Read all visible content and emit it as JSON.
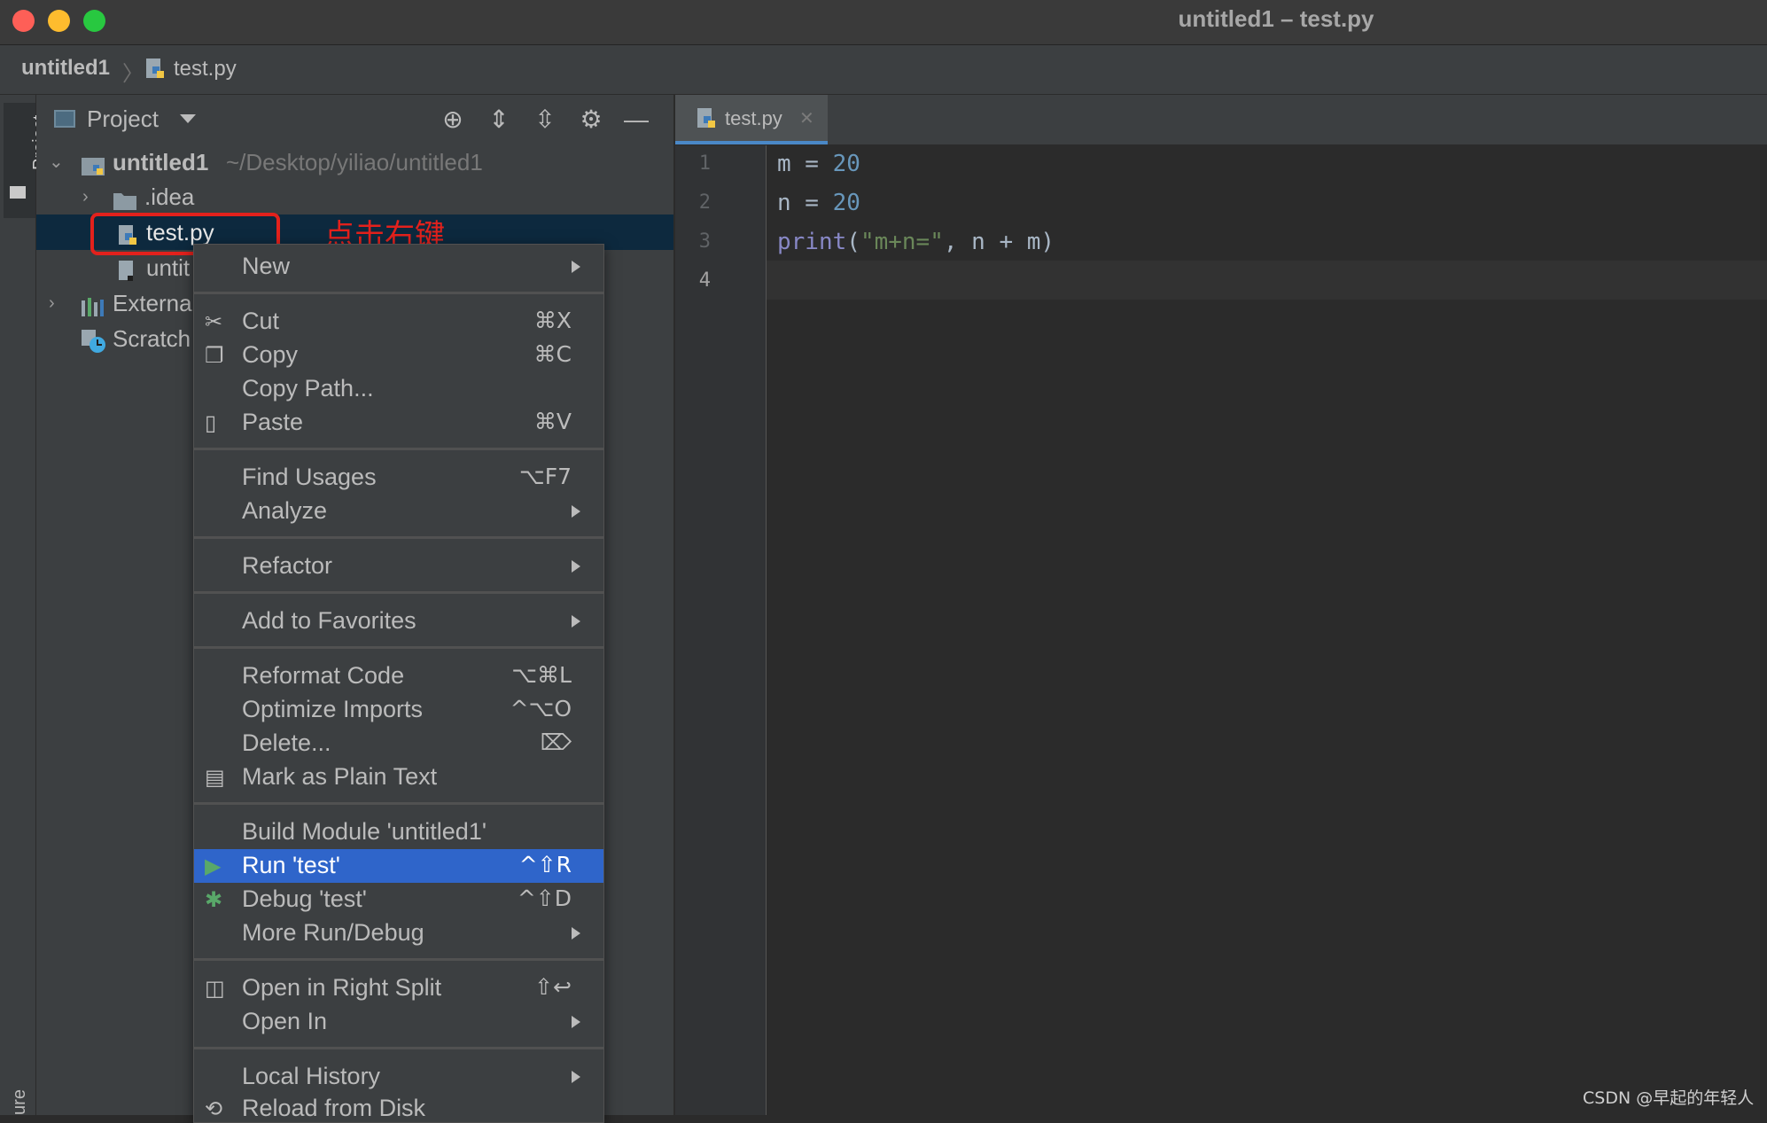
{
  "window": {
    "title": "untitled1 – test.py"
  },
  "breadcrumb": {
    "project": "untitled1",
    "separator": "〉",
    "file": "test.py"
  },
  "left_strip": {
    "project_label": "Project",
    "structure_label": "ure"
  },
  "project_panel": {
    "title": "Project",
    "tree": {
      "root_name": "untitled1",
      "root_path": "~/Desktop/yiliao/untitled1",
      "idea": ".idea",
      "test_file": "test.py",
      "untitled_file": "untit",
      "external": "Externa",
      "scratch": "Scratch"
    }
  },
  "annotation": {
    "text": "点击右键",
    "color": "#e3211c"
  },
  "editor": {
    "tab_label": "test.py",
    "tab_close": "✕",
    "line_numbers": [
      "1",
      "2",
      "3",
      "4"
    ],
    "code": {
      "l1_var": "m",
      "l1_op": " = ",
      "l1_num": "20",
      "l2_var": "n",
      "l2_op": " = ",
      "l2_num": "20",
      "l3_fn": "print",
      "l3_open": "(",
      "l3_str": "\"m+n=\"",
      "l3_rest": ", n + m)"
    }
  },
  "context_menu": {
    "new": "New",
    "cut": "Cut",
    "cut_sc": "⌘X",
    "copy": "Copy",
    "copy_sc": "⌘C",
    "copy_path": "Copy Path...",
    "paste": "Paste",
    "paste_sc": "⌘V",
    "find_usages": "Find Usages",
    "find_usages_sc": "⌥F7",
    "analyze": "Analyze",
    "refactor": "Refactor",
    "add_favorites": "Add to Favorites",
    "reformat": "Reformat Code",
    "reformat_sc": "⌥⌘L",
    "optimize": "Optimize Imports",
    "optimize_sc": "^⌥O",
    "delete": "Delete...",
    "delete_sc": "⌦",
    "mark_plain": "Mark as Plain Text",
    "build": "Build Module 'untitled1'",
    "run": "Run 'test'",
    "run_sc": "^⇧R",
    "debug": "Debug 'test'",
    "debug_sc": "^⇧D",
    "more_run": "More Run/Debug",
    "open_split": "Open in Right Split",
    "open_split_sc": "⇧↩",
    "open_in": "Open In",
    "local_history": "Local History",
    "reload": "Reload from Disk"
  },
  "watermark": "CSDN @早起的年轻人",
  "colors": {
    "accent": "#2f65ca",
    "run_icon": "#59a869",
    "tab_underline": "#4a88c7"
  }
}
